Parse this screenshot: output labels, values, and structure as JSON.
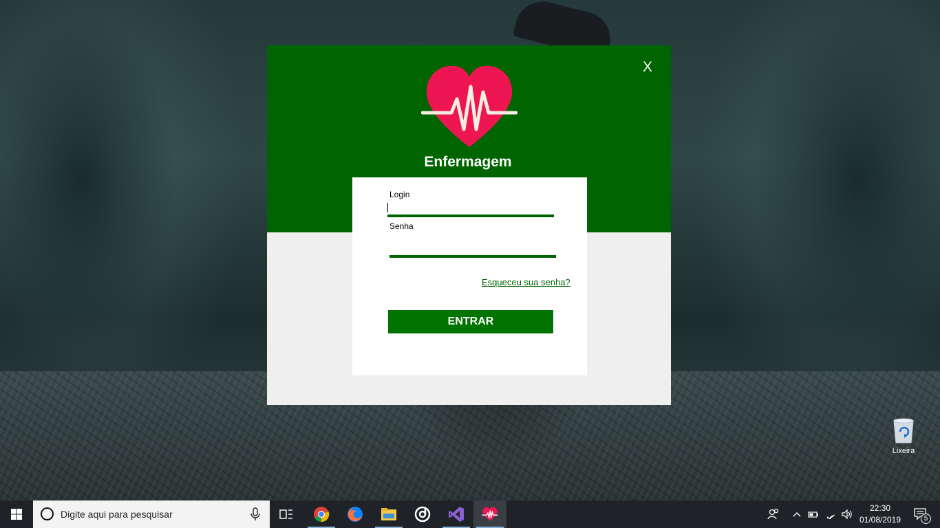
{
  "login_window": {
    "close_label": "X",
    "app_title": "Enfermagem",
    "login_label": "Login",
    "login_value": "",
    "password_label": "Senha",
    "password_value": "",
    "forgot_link": "Esqueceu sua senha?",
    "enter_button": "ENTRAR",
    "logo_icon": "heart-pulse-icon",
    "colors": {
      "header": "#006400",
      "button": "#007300",
      "logo": "#ee1652"
    }
  },
  "desktop": {
    "recycle_bin_label": "Lixeira"
  },
  "taskbar": {
    "search_placeholder": "Digite aqui para pesquisar",
    "apps": [
      "task-view-icon",
      "chrome-icon",
      "firefox-icon",
      "file-explorer-icon",
      "groove-icon",
      "visual-studio-icon",
      "heart-pulse-icon"
    ],
    "clock_time": "22:30",
    "clock_date": "01/08/2019",
    "notification_count": "5"
  }
}
